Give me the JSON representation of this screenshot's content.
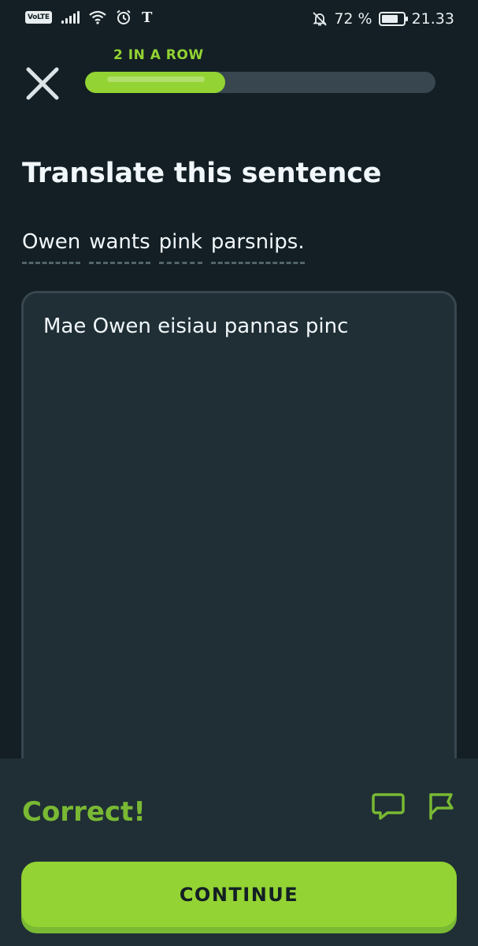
{
  "status_bar": {
    "network_badge": "VoLTE",
    "battery_percent": "72 %",
    "time": "21.33",
    "icons": [
      "signal-icon",
      "wifi-icon",
      "alarm-icon",
      "news-app-icon",
      "notifications-off-icon",
      "battery-icon"
    ]
  },
  "header": {
    "streak_label": "2 IN A ROW",
    "progress_fraction": 0.4,
    "close_icon": "close-icon"
  },
  "exercise": {
    "title": "Translate this sentence",
    "prompt_words": [
      "Owen",
      "wants",
      "pink",
      "parsnips."
    ],
    "answer": "Mae Owen eisiau pannas pinc"
  },
  "feedback": {
    "result": "Correct!",
    "icons": [
      "discuss-icon",
      "report-flag-icon"
    ],
    "continue_label": "CONTINUE"
  },
  "colors": {
    "background": "#131f24",
    "surface": "#202f36",
    "border": "#37464f",
    "accent_green": "#93d333",
    "correct_green": "#79b933",
    "text": "#f1f7fb"
  }
}
